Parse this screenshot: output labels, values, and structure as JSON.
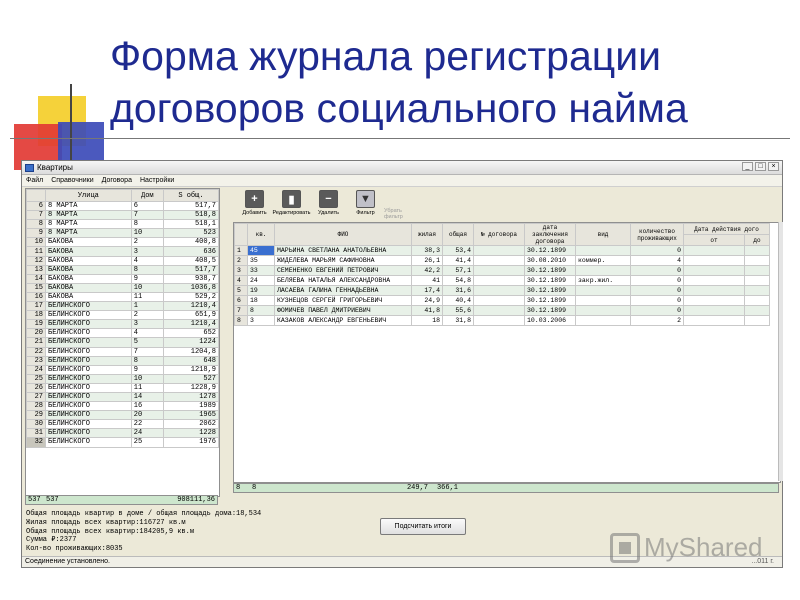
{
  "slide": {
    "title_line1": "Форма журнала регистрации",
    "title_line2": "договоров социального найма",
    "watermark": "MyShared"
  },
  "window": {
    "title": "Квартиры",
    "controls": [
      "_",
      "□",
      "×"
    ]
  },
  "menu": [
    "Файл",
    "Справочники",
    "Договора",
    "Настройки"
  ],
  "left_grid": {
    "columns": [
      "",
      "Улица",
      "Дом",
      "S общ."
    ],
    "rows": [
      [
        "6",
        "8 МАРТА",
        "6",
        "517,7"
      ],
      [
        "7",
        "8 МАРТА",
        "7",
        "518,8"
      ],
      [
        "8",
        "8 МАРТА",
        "8",
        "518,1"
      ],
      [
        "9",
        "8 МАРТА",
        "10",
        "523"
      ],
      [
        "10",
        "БАКОВА",
        "2",
        "400,8"
      ],
      [
        "11",
        "БАКОВА",
        "3",
        "636"
      ],
      [
        "12",
        "БАКОВА",
        "4",
        "408,5"
      ],
      [
        "13",
        "БАКОВА",
        "8",
        "517,7"
      ],
      [
        "14",
        "БАКОВА",
        "9",
        "938,7"
      ],
      [
        "15",
        "БАКОВА",
        "10",
        "1036,8"
      ],
      [
        "16",
        "БАКОВА",
        "11",
        "529,2"
      ],
      [
        "17",
        "БЕЛИНСКОГО",
        "1",
        "1210,4"
      ],
      [
        "18",
        "БЕЛИНСКОГО",
        "2",
        "651,9"
      ],
      [
        "19",
        "БЕЛИНСКОГО",
        "3",
        "1210,4"
      ],
      [
        "20",
        "БЕЛИНСКОГО",
        "4",
        "652"
      ],
      [
        "21",
        "БЕЛИНСКОГО",
        "5",
        "1224"
      ],
      [
        "22",
        "БЕЛИНСКОГО",
        "7",
        "1204,8"
      ],
      [
        "23",
        "БЕЛИНСКОГО",
        "8",
        "648"
      ],
      [
        "24",
        "БЕЛИНСКОГО",
        "9",
        "1218,9"
      ],
      [
        "25",
        "БЕЛИНСКОГО",
        "10",
        "527"
      ],
      [
        "26",
        "БЕЛИНСКОГО",
        "11",
        "1228,9"
      ],
      [
        "27",
        "БЕЛИНСКОГО",
        "14",
        "1278"
      ],
      [
        "28",
        "БЕЛИНСКОГО",
        "16",
        "1989"
      ],
      [
        "29",
        "БЕЛИНСКОГО",
        "20",
        "1965"
      ],
      [
        "30",
        "БЕЛИНСКОГО",
        "22",
        "2062"
      ],
      [
        "31",
        "БЕЛИНСКОГО",
        "24",
        "1228"
      ],
      [
        "32",
        "БЕЛИНСКОГО",
        "25",
        "1976"
      ]
    ],
    "footer": [
      "537",
      "537",
      "908111,36"
    ]
  },
  "toolbar": {
    "add": "Добавить",
    "edit": "Редактировать",
    "delete": "Удалить",
    "filter": "Фильтр",
    "remove_filter": "Убрать фильтр"
  },
  "right_grid": {
    "columns": [
      "",
      "кв.",
      "ФИО",
      "жилая",
      "общая",
      "№ договора",
      "дата заключения договора",
      "вид",
      "количество проживающих",
      "Дата действия дого"
    ],
    "sub_columns": [
      "от",
      "до"
    ],
    "rows": [
      [
        "1",
        "45",
        "МАРЬИНА СВЕТЛАНА АНАТОЛЬЕВНА",
        "38,3",
        "53,4",
        "",
        "30.12.1899",
        "",
        "0"
      ],
      [
        "2",
        "35",
        "ЖИДЕЛЕВА МАРЬЯМ САФИНОВНА",
        "26,1",
        "41,4",
        "",
        "30.08.2010",
        "коммер.",
        "4"
      ],
      [
        "3",
        "33",
        "СЕМЕНЕНКО ЕВГЕНИЙ ПЕТРОВИЧ",
        "42,2",
        "57,1",
        "",
        "30.12.1899",
        "",
        "0"
      ],
      [
        "4",
        "24",
        "БЕЛЯЕВА НАТАЛЬЯ АЛЕКСАНДРОВНА",
        "41",
        "54,8",
        "",
        "30.12.1899",
        "закр.жил.",
        "0"
      ],
      [
        "5",
        "19",
        "ЛАСАЕВА ГАЛИНА ГЕННАДЬЕВНА",
        "17,4",
        "31,6",
        "",
        "30.12.1899",
        "",
        "0"
      ],
      [
        "6",
        "18",
        "КУЗНЕЦОВ СЕРГЕЙ ГРИГОРЬЕВИЧ",
        "24,9",
        "40,4",
        "",
        "30.12.1899",
        "",
        "0"
      ],
      [
        "7",
        "8",
        "ФОМИЧЕВ ПАВЕЛ ДМИТРИЕВИЧ",
        "41,8",
        "55,6",
        "",
        "30.12.1899",
        "",
        "0"
      ],
      [
        "8",
        "3",
        "КАЗАКОВ АЛЕКСАНДР ЕВГЕНЬЕВИЧ",
        "18",
        "31,8",
        "",
        "10.03.2006",
        "",
        "2"
      ]
    ],
    "footer": [
      "8",
      "8",
      "249,7",
      "366,1"
    ]
  },
  "summary": {
    "line1": "Общая площадь квартир в доме / общая площадь дома:18,534",
    "line2": "Жилая площадь всех квартир:116727 кв.м",
    "line3": "Общая площадь всех квартир:184205,9 кв.м",
    "line4": "Сумма ₽:2377",
    "line5": "Кол-во проживающих:8035"
  },
  "calc_button": "Подсчитать итоги",
  "status": {
    "connection": "Соединение установлено.",
    "date": "...011 г."
  }
}
